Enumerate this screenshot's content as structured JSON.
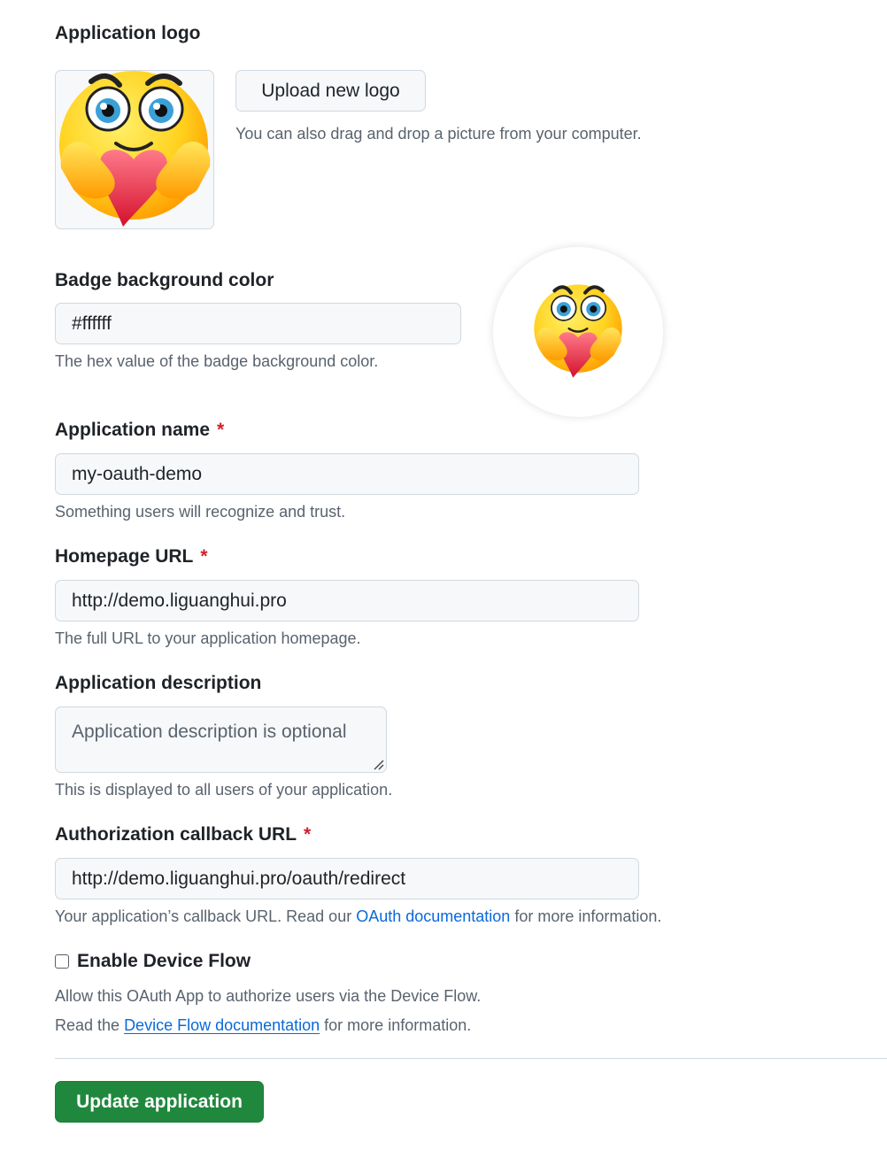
{
  "logo_section": {
    "label": "Application logo",
    "upload_button": "Upload new logo",
    "drag_hint": "You can also drag and drop a picture from your computer."
  },
  "badge": {
    "label": "Badge background color",
    "value": "#ffffff",
    "help": "The hex value of the badge background color."
  },
  "app_name": {
    "label": "Application name",
    "required_mark": "*",
    "value": "my-oauth-demo",
    "help": "Something users will recognize and trust."
  },
  "homepage": {
    "label": "Homepage URL",
    "required_mark": "*",
    "value": "http://demo.liguanghui.pro",
    "help": "The full URL to your application homepage."
  },
  "description": {
    "label": "Application description",
    "placeholder": "Application description is optional",
    "help": "This is displayed to all users of your application."
  },
  "callback": {
    "label": "Authorization callback URL",
    "required_mark": "*",
    "value": "http://demo.liguanghui.pro/oauth/redirect",
    "help_prefix": "Your application’s callback URL. Read our ",
    "help_link": "OAuth documentation",
    "help_suffix": " for more information."
  },
  "device_flow": {
    "label": "Enable Device Flow",
    "checked": false,
    "line1": "Allow this OAuth App to authorize users via the Device Flow.",
    "line2_prefix": "Read the ",
    "line2_link": "Device Flow documentation",
    "line2_suffix": " for more information."
  },
  "submit": {
    "label": "Update application"
  },
  "colors": {
    "primary": "#1f883d",
    "link": "#0969da",
    "required": "#cf222e",
    "emoji_face": "#ffd21f",
    "emoji_heart": "#e8243c"
  },
  "icons": {
    "logo": "hugging-face-emoji-icon",
    "badge": "hugging-face-emoji-icon"
  }
}
